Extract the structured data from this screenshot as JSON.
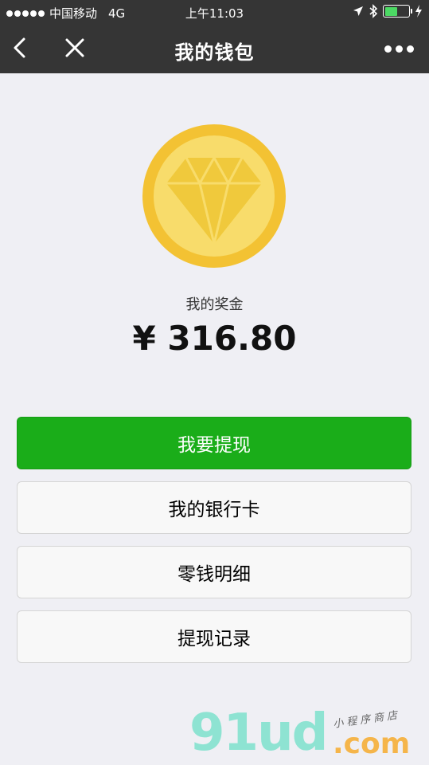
{
  "status_bar": {
    "carrier": "中国移动",
    "network": "4G",
    "time": "上午11:03"
  },
  "nav": {
    "title": "我的钱包"
  },
  "wallet": {
    "bonus_label": "我的奖金",
    "bonus_amount": "¥ 316.80"
  },
  "buttons": {
    "withdraw": "我要提现",
    "bank_card": "我的银行卡",
    "change_detail": "零钱明细",
    "withdraw_record": "提现记录"
  },
  "watermark": {
    "logo": "91ud",
    "domain": ".com",
    "tagline": "小程序商店"
  },
  "colors": {
    "bar_bg": "#353535",
    "page_bg": "#efeff4",
    "primary_green": "#1aad19",
    "coin_outer": "#f3c233",
    "coin_inner": "#f8dc6b",
    "battery_green": "#4cd964"
  }
}
